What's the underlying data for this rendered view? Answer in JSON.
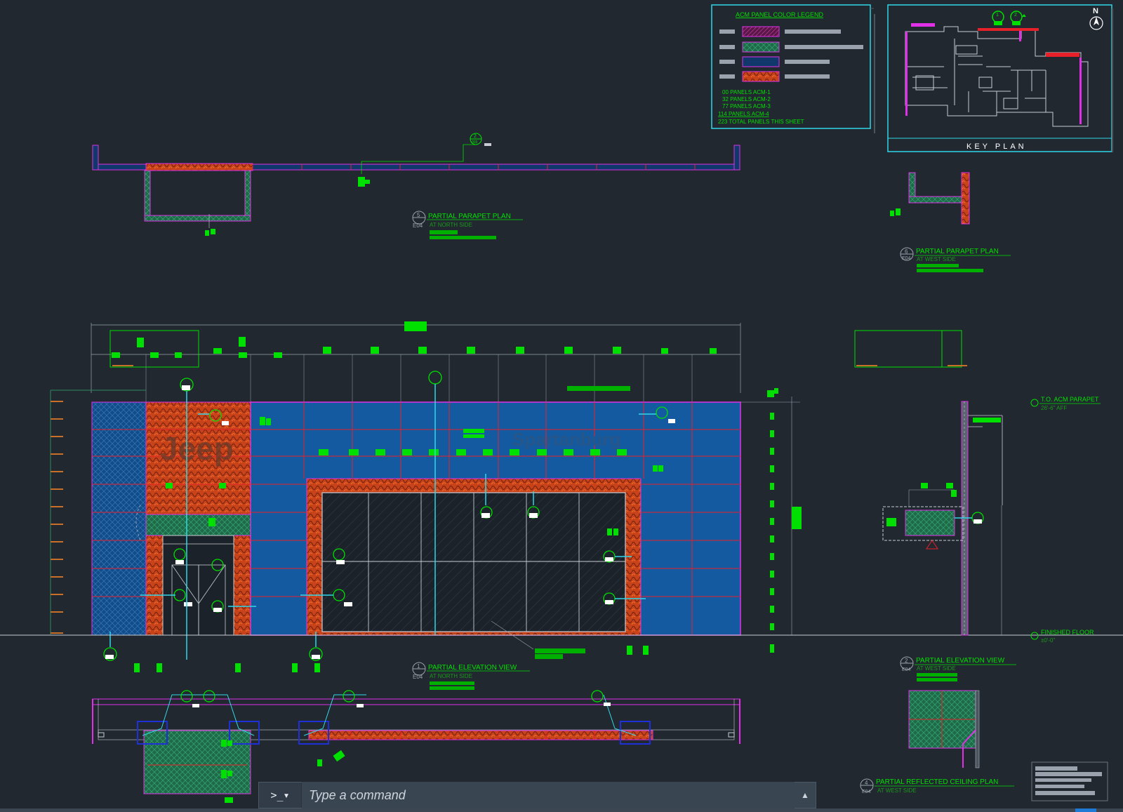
{
  "legend": {
    "title": "ACM PANEL COLOR LEGEND",
    "counts": [
      "00 PANELS ACM-1",
      "32 PANELS ACM-2",
      "77 PANELS ACM-3",
      "114 PANELS ACM-4",
      "223 TOTAL PANELS THIS SHEET"
    ],
    "swatch_colors": [
      "#7a1f55",
      "#1d6b4a",
      "#10386a",
      "#8a3a14"
    ]
  },
  "keyplan": {
    "title": "KEY PLAN",
    "north": "N",
    "callouts": [
      "1",
      "2"
    ]
  },
  "views": [
    {
      "num": "5",
      "sheet": "E04",
      "title": "PARTIAL PARAPET PLAN",
      "sub": "AT NORTH SIDE"
    },
    {
      "num": "6",
      "sheet": "E04",
      "title": "PARTIAL PARAPET PLAN",
      "sub": "AT WEST SIDE"
    },
    {
      "num": "1",
      "sheet": "E04",
      "title": "PARTIAL ELEVATION VIEW",
      "sub": "AT NORTH SIDE"
    },
    {
      "num": "2",
      "sheet": "E04",
      "title": "PARTIAL ELEVATION VIEW",
      "sub": "AT WEST SIDE"
    },
    {
      "num": "4",
      "sheet": "E04",
      "title": "PARTIAL REFLECTED CEILING PLAN",
      "sub": "AT WEST SIDE"
    }
  ],
  "levels": [
    {
      "name": "T.O. ACM PARAPET",
      "value": "26'-6\" AFF"
    },
    {
      "name": "FINISHED FLOOR",
      "value": "±0'-0\""
    }
  ],
  "signage": {
    "brand": "Jeep",
    "city": "Spartanburg"
  },
  "section_marker": {
    "num": "2",
    "sheet": "003"
  },
  "command": {
    "prompt": ">_",
    "placeholder": "Type a command"
  },
  "colors": {
    "background": "#212830",
    "cad_green": "#00e000",
    "cad_red": "#e8202a",
    "cad_magenta": "#e030e8",
    "cad_cyan": "#30d8e8",
    "acm_blue": "#145aa0",
    "acm_orange": "#c8431a",
    "acm_green": "#2a8a62"
  }
}
